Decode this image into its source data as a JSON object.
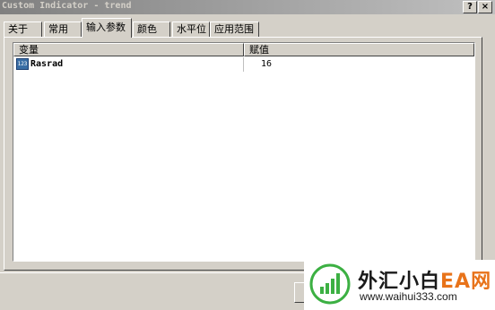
{
  "window": {
    "title": "Custom Indicator - trend",
    "help_label": "?",
    "close_label": "×"
  },
  "tabs": [
    {
      "label": "关于",
      "active": false
    },
    {
      "label": "常用",
      "active": false
    },
    {
      "label": "输入参数",
      "active": true
    },
    {
      "label": "颜色",
      "active": false
    },
    {
      "label": "水平位",
      "active": false
    },
    {
      "label": "应用范围",
      "active": false
    }
  ],
  "params": {
    "headers": {
      "variable": "变量",
      "value": "赋值"
    },
    "rows": [
      {
        "icon": "integer-param-icon",
        "icon_text": "123",
        "name": "Rasrad",
        "value": "16"
      }
    ]
  },
  "watermark": {
    "name_part1": "外汇小白",
    "name_part2": "EA网",
    "url": "www.waihui333.com",
    "colors": {
      "bars": "#3cb043",
      "text": "#1a1a1a",
      "accent": "#e8731a"
    }
  }
}
